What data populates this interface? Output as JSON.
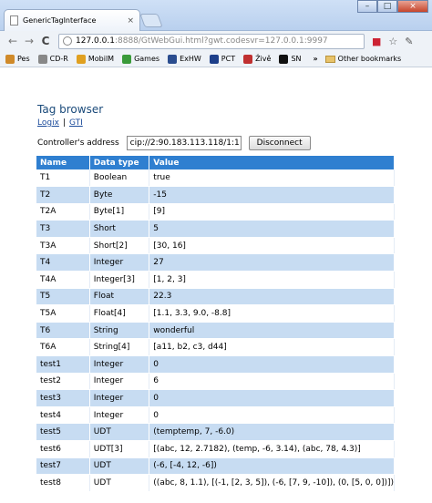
{
  "browser": {
    "tab_title": "GenericTagInterface",
    "tab_close": "×",
    "window_buttons": {
      "minimize": "–",
      "maximize": "□",
      "close": "×"
    },
    "url_host": "127.0.0.1",
    "url_rest": ":8888/GtWebGui.html?gwt.codesvr=127.0.0.1:9997",
    "bookmarks": [
      {
        "label": "Pes",
        "color": "#d08a2a"
      },
      {
        "label": "CD-R",
        "color": "#888888"
      },
      {
        "label": "MobilM",
        "color": "#e0a020"
      },
      {
        "label": "Games",
        "color": "#3a9a3a"
      },
      {
        "label": "ExHW",
        "color": "#2b4d8f"
      },
      {
        "label": "PCT",
        "color": "#1d3f8a"
      },
      {
        "label": "Živě",
        "color": "#c03030"
      },
      {
        "label": "SN",
        "color": "#111111"
      }
    ],
    "bookmarks_more": "»",
    "other_bookmarks": "Other bookmarks"
  },
  "page": {
    "title": "Tag browser",
    "link_logix": "Logix",
    "link_sep": "|",
    "link_gti": "GTI",
    "controller_label": "Controller's address",
    "controller_value": "cip://2:90.183.113.118/1:1",
    "disconnect_label": "Disconnect"
  },
  "table": {
    "headers": [
      "Name",
      "Data type",
      "Value"
    ],
    "rows": [
      [
        "T1",
        "Boolean",
        "true"
      ],
      [
        "T2",
        "Byte",
        "-15"
      ],
      [
        "T2A",
        "Byte[1]",
        "[9]"
      ],
      [
        "T3",
        "Short",
        "5"
      ],
      [
        "T3A",
        "Short[2]",
        "[30, 16]"
      ],
      [
        "T4",
        "Integer",
        "27"
      ],
      [
        "T4A",
        "Integer[3]",
        "[1, 2, 3]"
      ],
      [
        "T5",
        "Float",
        "22.3"
      ],
      [
        "T5A",
        "Float[4]",
        "[1.1, 3.3, 9.0, -8.8]"
      ],
      [
        "T6",
        "String",
        "wonderful"
      ],
      [
        "T6A",
        "String[4]",
        "[a11, b2, c3, d44]"
      ],
      [
        "test1",
        "Integer",
        "0"
      ],
      [
        "test2",
        "Integer",
        "6"
      ],
      [
        "test3",
        "Integer",
        "0"
      ],
      [
        "test4",
        "Integer",
        "0"
      ],
      [
        "test5",
        "UDT",
        "(temptemp, 7, -6.0)"
      ],
      [
        "test6",
        "UDT[3]",
        "[(abc, 12, 2.7182), (temp, -6, 3.14), (abc, 78, 4.3)]"
      ],
      [
        "test7",
        "UDT",
        "(-6, [-4, 12, -6])"
      ],
      [
        "test8",
        "UDT",
        "((abc, 8, 1.1), [(-1, [2, 3, 5]), (-6, [7, 9, -10]), (0, [5, 0, 0])])"
      ]
    ]
  }
}
